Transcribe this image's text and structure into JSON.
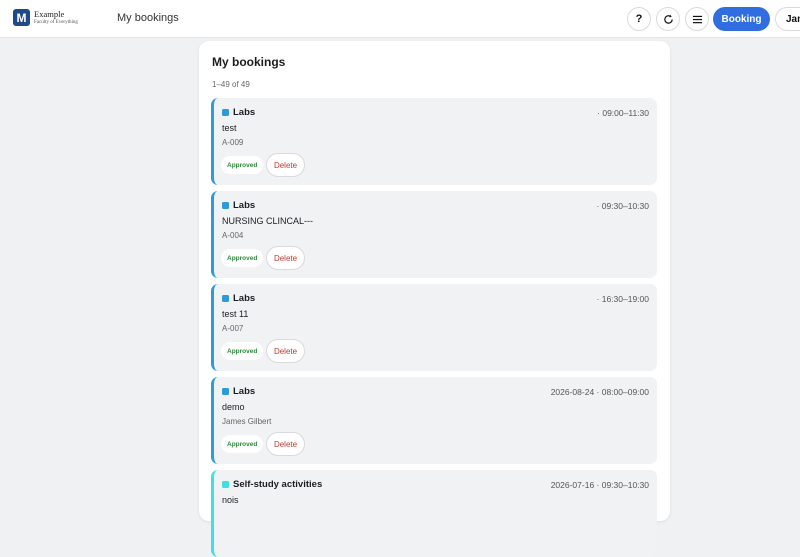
{
  "header": {
    "logo_letter": "M",
    "logo_name": "Example",
    "logo_tagline": "Faculty of Everything",
    "page_title": "My bookings",
    "help_label": "?",
    "refresh_label": "↻",
    "menu_label": "≡",
    "booking_label": "Booking",
    "user_label": "Jam"
  },
  "panel": {
    "title": "My bookings",
    "count": "1–49 of 49"
  },
  "colors": {
    "accent": "#2f6de0",
    "labs": "#2f9ad8",
    "self_study": "#3ee0e3",
    "approved": "#2e8b3a",
    "delete": "#c0392b"
  },
  "bookings": [
    {
      "category": "Labs",
      "time": "· 09:00–11:30",
      "title": "test",
      "sub": "A-009",
      "status": "Approved",
      "delete_label": "Delete"
    },
    {
      "category": "Labs",
      "time": "· 09:30–10:30",
      "title": "NURSING CLINCAL---",
      "sub": "A-004",
      "status": "Approved",
      "delete_label": "Delete"
    },
    {
      "category": "Labs",
      "time": "· 16:30–19:00",
      "title": "test 11",
      "sub": "A-007",
      "status": "Approved",
      "delete_label": "Delete"
    },
    {
      "category": "Labs",
      "time": "2026-08-24 · 08:00–09:00",
      "title": "demo",
      "sub": "James Gilbert",
      "status": "Approved",
      "delete_label": "Delete"
    },
    {
      "category": "Self-study activities",
      "time": "2026-07-16 · 09:30–10:30",
      "title": "nois",
      "sub": "",
      "status": "",
      "delete_label": ""
    }
  ]
}
